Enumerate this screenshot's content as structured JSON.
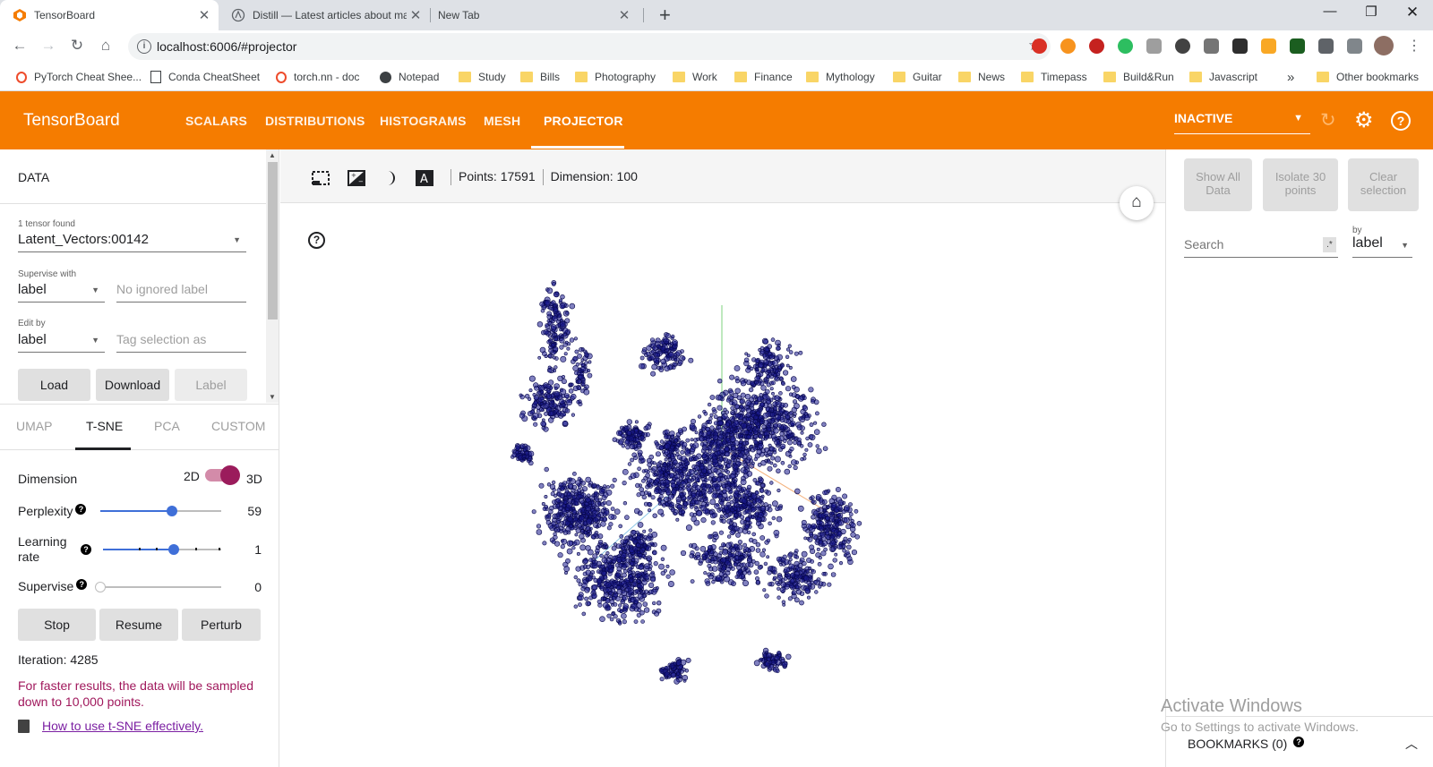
{
  "browser": {
    "tabs": [
      {
        "title": "TensorBoard",
        "active": true
      },
      {
        "title": "Distill — Latest articles about ma",
        "active": false
      },
      {
        "title": "New Tab",
        "active": false
      }
    ],
    "url": "localhost:6006/#projector",
    "bookmarks": [
      {
        "label": "PyTorch Cheat Shee...",
        "icon": "pytorch-icon"
      },
      {
        "label": "Conda CheatSheet",
        "icon": "page-icon"
      },
      {
        "label": "torch.nn - doc",
        "icon": "pytorch-icon"
      },
      {
        "label": "Notepad",
        "icon": "globe-icon"
      },
      {
        "label": "Study",
        "icon": "folder-icon"
      },
      {
        "label": "Bills",
        "icon": "folder-icon"
      },
      {
        "label": "Photography",
        "icon": "folder-icon"
      },
      {
        "label": "Work",
        "icon": "folder-icon"
      },
      {
        "label": "Finance",
        "icon": "folder-icon"
      },
      {
        "label": "Mythology",
        "icon": "folder-icon"
      },
      {
        "label": "Guitar",
        "icon": "folder-icon"
      },
      {
        "label": "News",
        "icon": "folder-icon"
      },
      {
        "label": "Timepass",
        "icon": "folder-icon"
      },
      {
        "label": "Build&Run",
        "icon": "folder-icon"
      },
      {
        "label": "Javascript",
        "icon": "folder-icon"
      }
    ],
    "more_bookmarks": "»",
    "other_bookmarks": "Other bookmarks"
  },
  "tensorboard": {
    "title": "TensorBoard",
    "nav": [
      "SCALARS",
      "DISTRIBUTIONS",
      "HISTOGRAMS",
      "MESH",
      "PROJECTOR"
    ],
    "active_nav": "PROJECTOR",
    "run_status": "INACTIVE",
    "accent_color": "#f57c00"
  },
  "data_panel": {
    "heading": "DATA",
    "tensor_found": "1 tensor found",
    "tensor_name": "Latent_Vectors:00142",
    "supervise_label": "Supervise with",
    "supervise_value": "label",
    "ignored_placeholder": "No ignored label",
    "edit_label": "Edit by",
    "edit_value": "label",
    "tag_placeholder": "Tag selection as",
    "buttons": {
      "load": "Load",
      "download": "Download",
      "label": "Label"
    }
  },
  "projection_tabs": [
    "UMAP",
    "T-SNE",
    "PCA",
    "CUSTOM"
  ],
  "active_projection": "T-SNE",
  "tsne": {
    "dimension_label": "Dimension",
    "dim_2d": "2D",
    "dim_3d": "3D",
    "dimension_3d": true,
    "perplexity_label": "Perplexity",
    "perplexity": "59",
    "perplexity_fraction": 0.59,
    "learning_rate_label": "Learning rate",
    "learning_rate": "1",
    "learning_rate_fraction": 0.6,
    "supervise_label": "Supervise",
    "supervise": "0",
    "supervise_fraction": 0,
    "buttons": {
      "stop": "Stop",
      "resume": "Resume",
      "perturb": "Perturb"
    },
    "iteration": "Iteration: 4285",
    "sample_note": "For faster results, the data will be sampled down to 10,000 points.",
    "howto_link": "How to use t-SNE effectively."
  },
  "viewer": {
    "points": "Points: 17591",
    "dimension": "Dimension: 100",
    "point_color": "#1a1a8c"
  },
  "inspector": {
    "show_all": "Show All Data",
    "isolate": "Isolate 30 points",
    "clear": "Clear selection",
    "search_placeholder": "Search",
    "regex_toggle": ".*",
    "by_label": "by",
    "by_value": "label",
    "bookmarks": "BOOKMARKS (0)"
  },
  "watermark": {
    "line1": "Activate Windows",
    "line2": "Go to Settings to activate Windows."
  }
}
